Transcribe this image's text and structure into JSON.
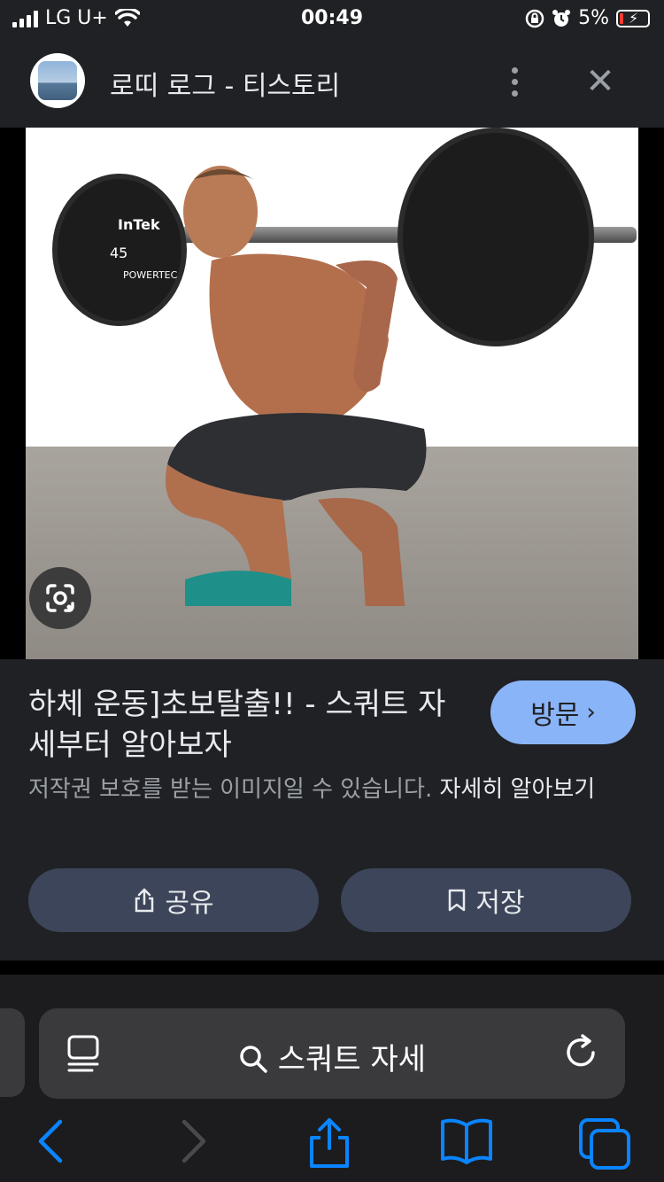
{
  "status_bar": {
    "carrier": "LG U+",
    "time": "00:49",
    "battery": "5%"
  },
  "header": {
    "title": "로띠 로그 - 티스토리"
  },
  "result": {
    "title": "하체 운동]초보탈출!! - 스쿼트 자세부터 알아보자",
    "visit_label": "방문",
    "copyright_text": "저작권 보호를 받는 이미지일 수 있습니다.",
    "learn_more": "자세히 알아보기",
    "share_label": "공유",
    "save_label": "저장"
  },
  "image_text": {
    "plate_weight": "45",
    "plate_brand": "POWERTEC",
    "plate_logo": "InTek"
  },
  "address_bar": {
    "query": "스쿼트 자세"
  },
  "colors": {
    "accent": "#8ab4f8",
    "safari_blue": "#0a84ff"
  }
}
